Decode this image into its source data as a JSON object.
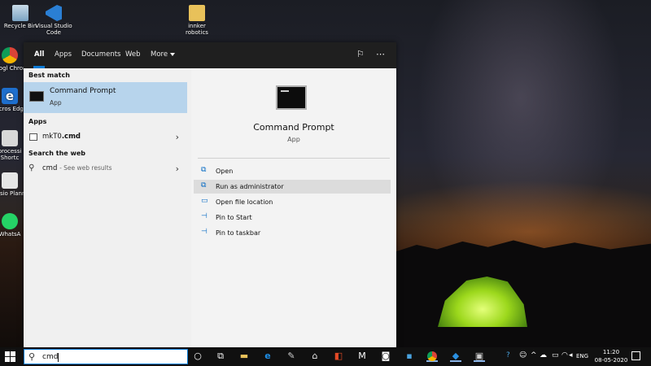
{
  "desktop": {
    "icons": [
      {
        "label": "Recycle Bin",
        "icon": "recycle-bin-icon"
      },
      {
        "label": "Visual Studio Code",
        "icon": "vscode-icon"
      },
      {
        "label": "innker robotics",
        "icon": "folder-icon"
      },
      {
        "label": "Googl Chrom",
        "icon": "chrome-icon"
      },
      {
        "label": "Micros Edge",
        "icon": "edge-icon"
      },
      {
        "label": "processi Shortc",
        "icon": "shortcut-icon"
      },
      {
        "label": "Missio Planne",
        "icon": "mission-planner-icon"
      },
      {
        "label": "WhatsA",
        "icon": "whatsapp-icon"
      }
    ]
  },
  "search_panel": {
    "tabs": [
      "All",
      "Apps",
      "Documents",
      "Web",
      "More"
    ],
    "active_tab": "All",
    "best_match_header": "Best match",
    "best_match": {
      "title": "Command Prompt",
      "subtitle": "App"
    },
    "apps_header": "Apps",
    "apps": [
      {
        "name_normal": "mkT0",
        "name_bold": ".cmd"
      }
    ],
    "web_header": "Search the web",
    "web_result": {
      "query": "cmd",
      "hint": "- See web results"
    },
    "detail": {
      "title": "Command Prompt",
      "subtitle": "App",
      "actions": [
        "Open",
        "Run as administrator",
        "Open file location",
        "Pin to Start",
        "Pin to taskbar"
      ],
      "hovered_action": "Run as administrator"
    }
  },
  "taskbar": {
    "search_value": "cmd",
    "language": "ENG",
    "time": "11:20",
    "date": "08-05-2020",
    "accent_color": "#0a7bd4"
  }
}
